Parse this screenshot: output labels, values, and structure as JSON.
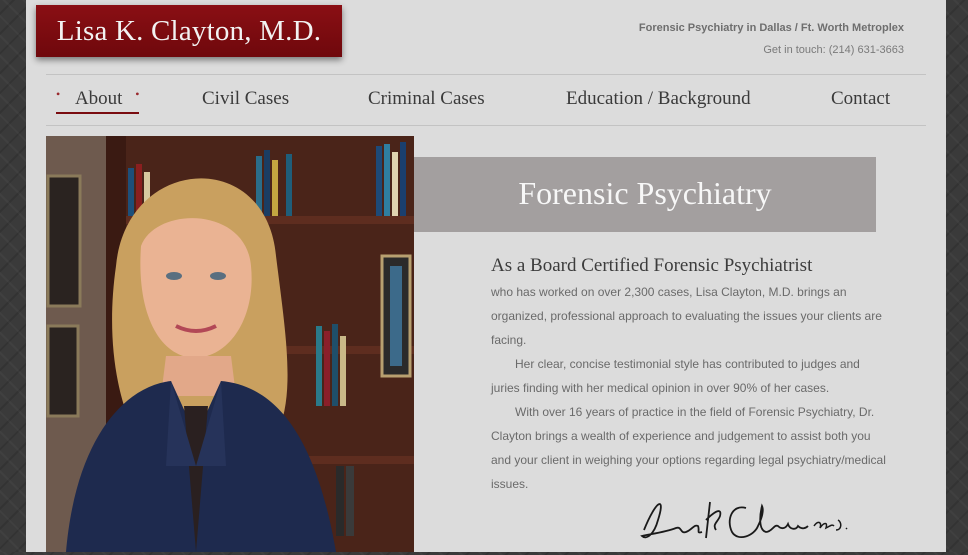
{
  "brand": {
    "name": "Lisa K. Clayton, M.D."
  },
  "header": {
    "tagline": "Forensic Psychiatry in Dallas / Ft. Worth Metroplex",
    "contact": "Get in touch: (214) 631-3663"
  },
  "nav": {
    "items": [
      {
        "label": "About",
        "active": true
      },
      {
        "label": "Civil Cases"
      },
      {
        "label": "Criminal Cases"
      },
      {
        "label": "Education / Background"
      },
      {
        "label": "Contact"
      }
    ],
    "active_marker": "•"
  },
  "hero": {
    "banner_title": "Forensic Psychiatry"
  },
  "content": {
    "heading": "As a Board Certified Forensic Psychiatrist",
    "paragraphs": [
      "who has worked on over 2,300 cases, Lisa Clayton, M.D. brings an organized, professional approach to evaluating the issues your clients are facing.",
      "Her clear, concise testimonial style has contributed to judges and juries finding with her medical opinion in over 90% of her cases.",
      "With over 16 years of practice in the field of Forensic Psychiatry, Dr. Clayton brings a wealth of experience and judgement to assist both you and your client in weighing your options regarding legal psychiatry/medical issues."
    ],
    "signature": "Lisa K Clayton M.D."
  },
  "colors": {
    "brand_red": "#7a0c10",
    "banner_gray": "#a39f9f",
    "page_bg": "#dcdcdc"
  }
}
